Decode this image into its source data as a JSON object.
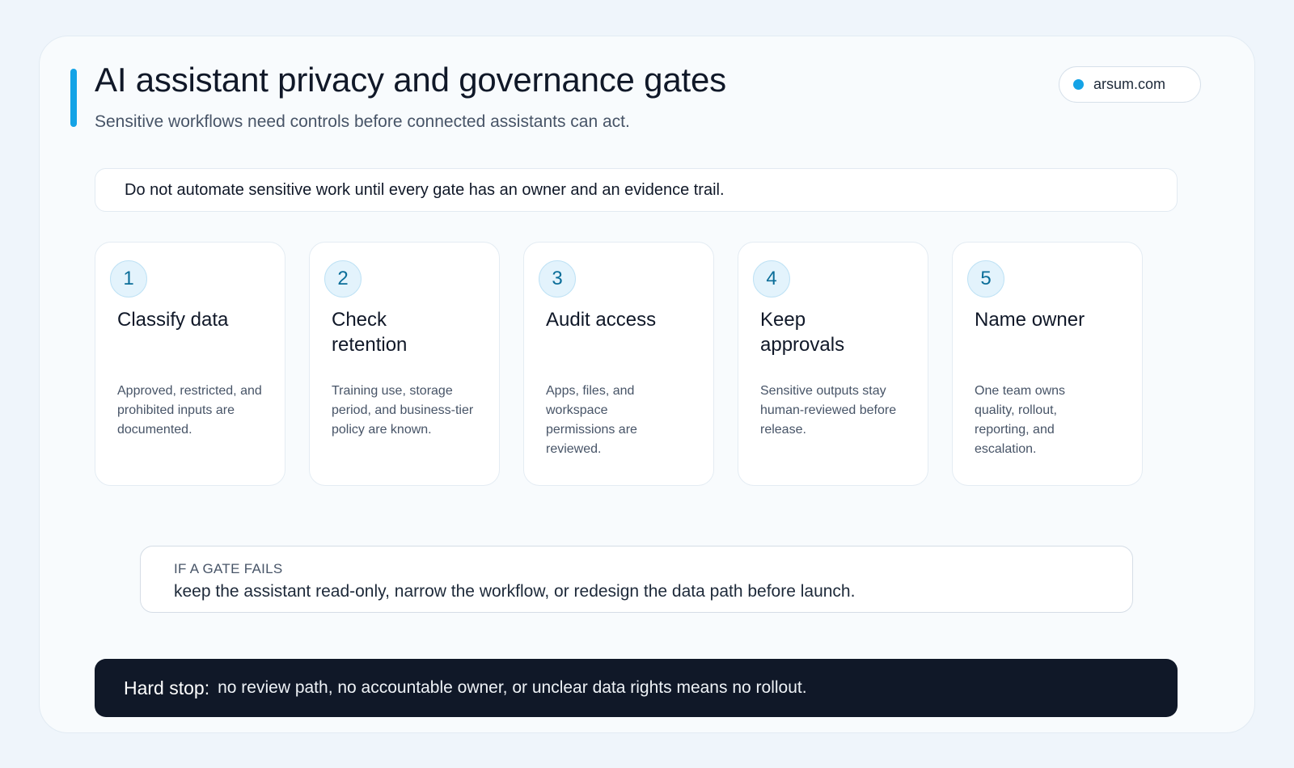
{
  "header": {
    "title": "AI assistant privacy and governance gates",
    "subtitle": "Sensitive workflows need controls before connected assistants can act.",
    "domain": "arsum.com"
  },
  "rule": "Do not automate sensitive work until every gate has an owner and an evidence trail.",
  "gates": [
    {
      "number": "1",
      "title": "Classify data",
      "description": "Approved, restricted, and prohibited inputs are documented."
    },
    {
      "number": "2",
      "title": "Check retention",
      "description": "Training use, storage period, and business-tier policy are known."
    },
    {
      "number": "3",
      "title": "Audit access",
      "description": "Apps, files, and workspace permissions are reviewed."
    },
    {
      "number": "4",
      "title": "Keep approvals",
      "description": "Sensitive outputs stay human-reviewed before release."
    },
    {
      "number": "5",
      "title": "Name owner",
      "description": "One team owns quality, rollout, reporting, and escalation."
    }
  ],
  "fallback": {
    "label": "IF A GATE FAILS",
    "text": "keep the assistant read-only, narrow the workflow, or redesign the data path before launch."
  },
  "hard_stop": {
    "label": "Hard stop:",
    "text": "no review path, no accountable owner, or unclear data rights means no rollout."
  },
  "colors": {
    "accent": "#14a3e6",
    "dark": "#101828",
    "background": "#eff5fb"
  }
}
